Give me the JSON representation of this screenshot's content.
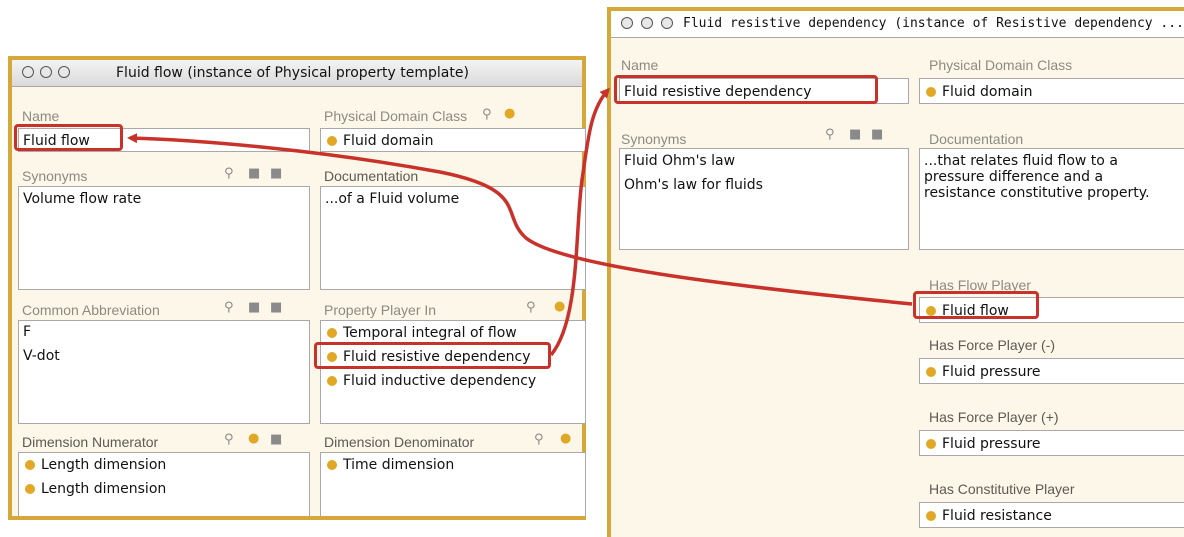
{
  "left": {
    "title": "Fluid flow  (instance of Physical property template)",
    "name_label": "Name",
    "name_value": "Fluid flow",
    "pdc_label": "Physical Domain Class",
    "pdc_value": "Fluid domain",
    "synonyms_label": "Synonyms",
    "synonyms": [
      "Volume flow rate"
    ],
    "doc_label": "Documentation",
    "doc_value": "...of a Fluid volume",
    "abbrev_label": "Common Abbreviation",
    "abbrevs": [
      "F",
      "V-dot"
    ],
    "ppi_label": "Property Player In",
    "ppi": [
      "Temporal integral of flow",
      "Fluid resistive dependency",
      "Fluid inductive dependency"
    ],
    "num_label": "Dimension Numerator",
    "numerators": [
      "Length dimension",
      "Length dimension"
    ],
    "den_label": "Dimension Denominator",
    "denominators": [
      "Time dimension"
    ]
  },
  "right": {
    "title": "Fluid resistive dependency  (instance of Resistive dependency ...",
    "name_label": "Name",
    "name_value": "Fluid resistive dependency",
    "pdc_label": "Physical Domain Class",
    "pdc_value": "Fluid domain",
    "synonyms_label": "Synonyms",
    "synonyms": [
      "Fluid Ohm's law",
      "Ohm's law  for fluids"
    ],
    "doc_label": "Documentation",
    "doc_lines": [
      "...that relates fluid flow to a",
      "pressure difference and a",
      "resistance constitutive property."
    ],
    "flow_label": "Has Flow Player",
    "flow_value": "Fluid flow",
    "force_minus_label": "Has Force Player (-)",
    "force_minus_value": "Fluid pressure",
    "force_plus_label": "Has Force Player (+)",
    "force_plus_value": "Fluid pressure",
    "const_label": "Has Constitutive Player",
    "const_value": "Fluid resistance"
  },
  "colors": {
    "frame": "#d6a83a",
    "highlight": "#c8322a",
    "bullet": "#e0a825",
    "panel": "#fcf7e8"
  },
  "icons": [
    "window-close-icon",
    "window-minimize-icon",
    "window-zoom-icon",
    "view-instance-icon",
    "create-instance-icon",
    "add-instance-icon",
    "remove-instance-icon"
  ]
}
